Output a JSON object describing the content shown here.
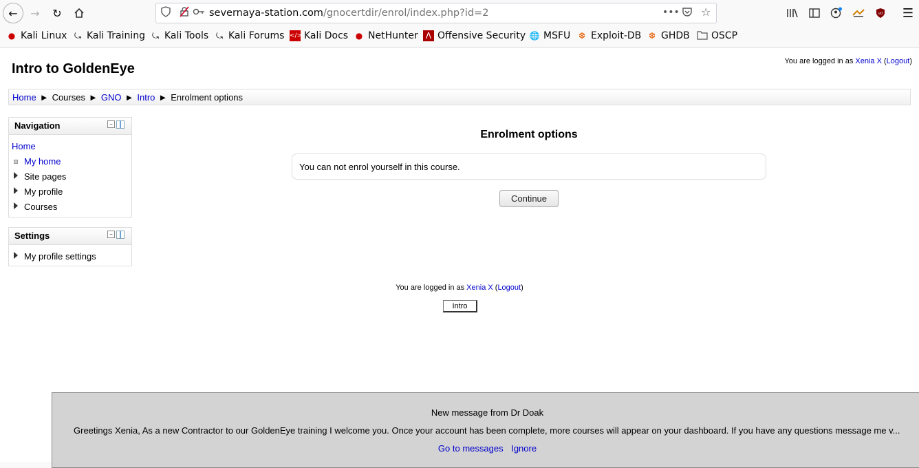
{
  "browser": {
    "url_host": "severnaya-station.com",
    "url_path": "/gnocertdir/enrol/index.php?id=2",
    "url_more": "•••",
    "bookmarks": [
      {
        "label": "Kali Linux",
        "icon": "kali-icon"
      },
      {
        "label": "Kali Training",
        "icon": "kali-dragon-icon"
      },
      {
        "label": "Kali Tools",
        "icon": "kali-dragon-icon"
      },
      {
        "label": "Kali Forums",
        "icon": "kali-dragon-icon"
      },
      {
        "label": "Kali Docs",
        "icon": "docs-icon"
      },
      {
        "label": "NetHunter",
        "icon": "kali-icon"
      },
      {
        "label": "Offensive Security",
        "icon": "offsec-icon"
      },
      {
        "label": "MSFU",
        "icon": "globe-icon"
      },
      {
        "label": "Exploit-DB",
        "icon": "exploitdb-icon"
      },
      {
        "label": "GHDB",
        "icon": "exploitdb-icon"
      },
      {
        "label": "OSCP",
        "icon": "folder-icon"
      }
    ]
  },
  "header": {
    "site_title": "Intro to GoldenEye",
    "logged_in_prefix": "You are logged in as ",
    "user_name": "Xenia X",
    "logout_open": " (",
    "logout_label": "Logout",
    "logout_close": ")"
  },
  "breadcrumb": {
    "items": [
      "Home",
      "Courses",
      "GNO",
      "Intro",
      "Enrolment options"
    ],
    "separator": "►"
  },
  "navigation": {
    "title": "Navigation",
    "home": "Home",
    "items": [
      "My home",
      "Site pages",
      "My profile",
      "Courses"
    ]
  },
  "settings": {
    "title": "Settings",
    "items": [
      "My profile settings"
    ]
  },
  "main": {
    "title": "Enrolment options",
    "notice": "You can not enrol yourself in this course.",
    "continue_label": "Continue"
  },
  "footer": {
    "logged_in_prefix": "You are logged in as ",
    "user_name": "Xenia X",
    "logout_label": "Logout",
    "course_button": "Intro"
  },
  "message": {
    "title": "New message from Dr Doak",
    "body": "Greetings Xenia, As a new Contractor to our GoldenEye training I welcome you. Once your account has been complete, more courses will appear on your dashboard. If you have any questions message me v...",
    "go_label": "Go to messages",
    "ignore_label": "Ignore"
  },
  "colors": {
    "link": "#0000cc",
    "message_bg": "#d3d3d3"
  }
}
